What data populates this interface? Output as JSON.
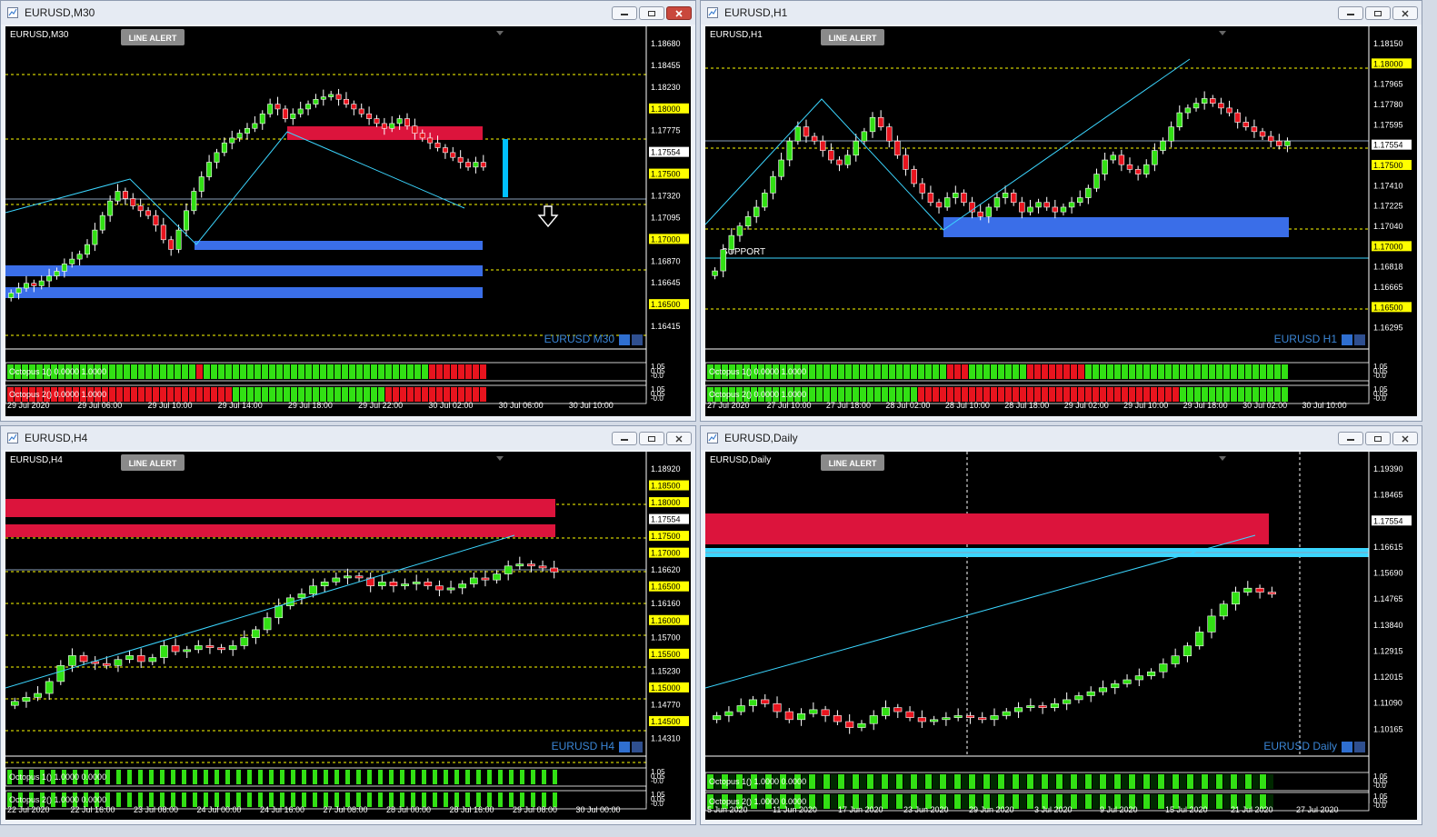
{
  "colors": {
    "bull": "#32e014",
    "bear": "#e8141e",
    "bg": "#000000",
    "grid": "#ffff00",
    "axis": "#ffffff",
    "bid": "#3bd6ff",
    "resistance_zone": "#dc143c",
    "support_zone": "#3a6ee8",
    "marker_bar": "#00c0ff",
    "label_blue": "#3b86d6",
    "price_tag": "#ffff00",
    "current_tag": "#ffffff"
  },
  "common": {
    "line_alert": "LINE ALERT",
    "octopus1": "Octopus 1() 0.0000 1.0000",
    "octopus2": "Octopus 2() 0.0000 1.0000",
    "octopus1_alt": "Octopus 1() 1.0000 0.0000",
    "octopus2_alt": "Octopus 2() 1.0000 0.0000",
    "osc_scale": [
      "1.05",
      "0.05",
      "-0.0"
    ]
  },
  "windows": [
    {
      "id": "m30",
      "title": "EURUSD,M30",
      "chart_label": "EURUSD,M30",
      "corner_label": "EURUSD M30",
      "osc1_label": "Octopus 1() 0.0000 1.0000",
      "osc2_label": "Octopus 2() 0.0000 1.0000",
      "price_labels": [
        "1.18680",
        "1.18455",
        "1.18230",
        "1.18000",
        "1.17775",
        "1.17554",
        "1.17500",
        "1.17320",
        "1.17095",
        "1.17000",
        "1.16870",
        "1.16645",
        "1.16500",
        "1.16415"
      ],
      "time_labels": [
        "29 Jul 2020",
        "29 Jul 06:00",
        "29 Jul 10:00",
        "29 Jul 14:00",
        "29 Jul 18:00",
        "29 Jul 22:00",
        "30 Jul 02:00",
        "30 Jul 06:00",
        "30 Jul 10:00"
      ]
    },
    {
      "id": "h1",
      "title": "EURUSD,H1",
      "chart_label": "EURUSD,H1",
      "corner_label": "EURUSD H1",
      "support_label": "SUPPORT",
      "osc1_label": "Octopus 1() 0.0000 1.0000",
      "osc2_label": "Octopus 2() 0.0000 1.0000",
      "price_labels": [
        "1.18150",
        "1.18000",
        "1.17965",
        "1.17780",
        "1.17595",
        "1.17554",
        "1.17500",
        "1.17410",
        "1.17225",
        "1.17040",
        "1.17000",
        "1.16818",
        "1.16665",
        "1.16500",
        "1.16295"
      ],
      "time_labels": [
        "27 Jul 2020",
        "27 Jul 10:00",
        "27 Jul 18:00",
        "28 Jul 02:00",
        "28 Jul 10:00",
        "28 Jul 18:00",
        "29 Jul 02:00",
        "29 Jul 10:00",
        "29 Jul 18:00",
        "30 Jul 02:00",
        "30 Jul 10:00"
      ]
    },
    {
      "id": "h4",
      "title": "EURUSD,H4",
      "chart_label": "EURUSD,H4",
      "corner_label": "EURUSD H4",
      "osc1_label": "Octopus 1() 1.0000 0.0000",
      "osc2_label": "Octopus 2() 1.0000 0.0000",
      "price_labels": [
        "1.18920",
        "1.18500",
        "1.18000",
        "1.17554",
        "1.17500",
        "1.17000",
        "1.16620",
        "1.16500",
        "1.16160",
        "1.16000",
        "1.15700",
        "1.15500",
        "1.15230",
        "1.15000",
        "1.14770",
        "1.14500",
        "1.14310"
      ],
      "time_labels": [
        "22 Jul 2020",
        "22 Jul 16:00",
        "23 Jul 08:00",
        "24 Jul 00:00",
        "24 Jul 16:00",
        "27 Jul 08:00",
        "28 Jul 00:00",
        "28 Jul 16:00",
        "29 Jul 08:00",
        "30 Jul 00:00"
      ]
    },
    {
      "id": "d1",
      "title": "EURUSD,Daily",
      "chart_label": "EURUSD,Daily",
      "corner_label": "EURUSD Daily",
      "osc1_label": "Octopus 1() 1.0000 0.0000",
      "osc2_label": "Octopus 2() 1.0000 0.0000",
      "price_labels": [
        "1.19390",
        "1.18465",
        "1.17554",
        "1.16615",
        "1.15690",
        "1.14765",
        "1.13840",
        "1.12915",
        "1.12015",
        "1.11090",
        "1.10165"
      ],
      "time_labels": [
        "5 Jun 2020",
        "11 Jun 2020",
        "17 Jun 2020",
        "23 Jun 2020",
        "29 Jun 2020",
        "3 Jul 2020",
        "9 Jul 2020",
        "15 Jul 2020",
        "21 Jul 2020",
        "27 Jul 2020"
      ]
    }
  ],
  "series": {
    "m30": {
      "trend": [
        0.08,
        0.1,
        0.12,
        0.11,
        0.13,
        0.15,
        0.17,
        0.2,
        0.22,
        0.24,
        0.28,
        0.34,
        0.4,
        0.46,
        0.5,
        0.47,
        0.44,
        0.42,
        0.4,
        0.36,
        0.3,
        0.26,
        0.34,
        0.42,
        0.5,
        0.56,
        0.62,
        0.66,
        0.7,
        0.72,
        0.74,
        0.76,
        0.78,
        0.82,
        0.86,
        0.84,
        0.8,
        0.82,
        0.84,
        0.86,
        0.88,
        0.89,
        0.9,
        0.88,
        0.86,
        0.84,
        0.82,
        0.8,
        0.78,
        0.76,
        0.78,
        0.8,
        0.77,
        0.74,
        0.72,
        0.7,
        0.68,
        0.66,
        0.64,
        0.62,
        0.6,
        0.62,
        0.6
      ]
    },
    "h1": {
      "trend": [
        0.15,
        0.24,
        0.3,
        0.34,
        0.38,
        0.42,
        0.48,
        0.55,
        0.62,
        0.7,
        0.76,
        0.72,
        0.7,
        0.66,
        0.62,
        0.6,
        0.64,
        0.7,
        0.74,
        0.8,
        0.76,
        0.7,
        0.64,
        0.58,
        0.52,
        0.48,
        0.44,
        0.42,
        0.46,
        0.48,
        0.44,
        0.4,
        0.38,
        0.42,
        0.46,
        0.48,
        0.44,
        0.4,
        0.42,
        0.44,
        0.42,
        0.4,
        0.42,
        0.44,
        0.46,
        0.5,
        0.56,
        0.62,
        0.64,
        0.6,
        0.58,
        0.56,
        0.6,
        0.66,
        0.7,
        0.76,
        0.82,
        0.84,
        0.86,
        0.88,
        0.86,
        0.84,
        0.82,
        0.78,
        0.76,
        0.74,
        0.72,
        0.7,
        0.68,
        0.7
      ]
    },
    "h4": {
      "trend": [
        0.1,
        0.12,
        0.14,
        0.2,
        0.28,
        0.33,
        0.3,
        0.29,
        0.28,
        0.31,
        0.33,
        0.3,
        0.32,
        0.38,
        0.35,
        0.36,
        0.38,
        0.37,
        0.36,
        0.38,
        0.42,
        0.46,
        0.52,
        0.58,
        0.62,
        0.64,
        0.68,
        0.7,
        0.72,
        0.73,
        0.72,
        0.68,
        0.7,
        0.68,
        0.69,
        0.7,
        0.68,
        0.66,
        0.67,
        0.69,
        0.72,
        0.71,
        0.74,
        0.78,
        0.79,
        0.78,
        0.77,
        0.75
      ]
    },
    "d1": {
      "trend": [
        0.1,
        0.12,
        0.15,
        0.18,
        0.16,
        0.12,
        0.08,
        0.11,
        0.13,
        0.1,
        0.07,
        0.04,
        0.06,
        0.1,
        0.14,
        0.12,
        0.09,
        0.07,
        0.08,
        0.09,
        0.1,
        0.09,
        0.08,
        0.1,
        0.12,
        0.14,
        0.15,
        0.14,
        0.16,
        0.18,
        0.2,
        0.22,
        0.24,
        0.26,
        0.28,
        0.3,
        0.32,
        0.36,
        0.4,
        0.45,
        0.52,
        0.6,
        0.66,
        0.72,
        0.74,
        0.72,
        0.71
      ]
    }
  }
}
